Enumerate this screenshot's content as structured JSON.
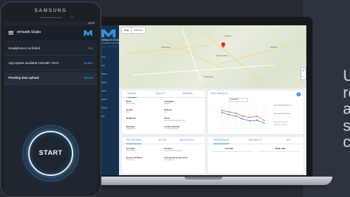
{
  "background_text": {
    "lines": [
      "U",
      "re",
      "a",
      "s",
      "c"
    ]
  },
  "phone": {
    "brand": "SAMSUNG",
    "status_time": "10:30",
    "app_title": "mHealth Studio",
    "rows": [
      {
        "label": "Headphones not linked",
        "action": "link"
      },
      {
        "label": "App update available mHealth +SHS",
        "action": "update"
      },
      {
        "label": "Pending data upload",
        "action": "upload"
      }
    ],
    "start_label": "START"
  },
  "laptop": {
    "brand": "mHEALTH",
    "brand_sub": "STUDIO",
    "sidebar_sub": "mhealthtech.org/mobile",
    "sidebar_items": [
      "Home",
      "Tests",
      "Patients",
      "Results",
      "Clinics",
      "Reports",
      "Settings",
      "Help"
    ],
    "map": {
      "tabs": [
        "Map",
        "Satellite"
      ],
      "towns": [
        "Pretoria",
        "Johannesburg",
        "Vereeniging",
        "Rustenburg",
        "Witbank"
      ]
    },
    "patient_card": {
      "tabs": [
        "PATIENT",
        "FACILITY",
        "GENERAL"
      ],
      "fields": [
        {
          "label": "Name",
          "value": "Jane Smith"
        },
        {
          "label": "Language",
          "value": "English"
        },
        {
          "label": "Gender",
          "value": "Male"
        },
        {
          "label": "Referral",
          "value": "Left"
        },
        {
          "label": "ID Number",
          "value": ""
        },
        {
          "label": "Email",
          "value": "jane.smith@example.com"
        },
        {
          "label": "Birthdate",
          "value": "1990/06/20"
        },
        {
          "label": "Contact Number",
          "value": "+27 81 000 0000"
        }
      ]
    },
    "test_card": {
      "tabs": [
        "TEST DETAILS",
        "NOTES",
        "DEVICE INFO"
      ],
      "fields": [
        {
          "label": "Test Date",
          "value": "2017/01/20"
        },
        {
          "label": "Duration",
          "value": "7 Minutes 30 Seconds"
        },
        {
          "label": "Tester Full Name",
          "value": "John Doe"
        },
        {
          "label": "Average Response Time",
          "value": "0.8 Seconds"
        }
      ]
    },
    "results_card": {
      "title": "TEST RESULTS",
      "select_label": "Audiogram",
      "legend": [
        "Unmasked Air (Right Ear)",
        "Unmasked Air (Left Ear)",
        "Right Ear Threshold",
        "Left Ear Threshold"
      ]
    },
    "thresholds_card": {
      "tabs": [
        "THRESHOLDS",
        "RELIABILITY",
        "SPL"
      ],
      "left_label": "Left (dB)",
      "right_label": "Right (dB)"
    },
    "colors": {
      "sidebar": "#163150",
      "accent": "#3a8fd8",
      "right_ear": "#e05a5a",
      "left_ear": "#4a7fd6"
    }
  }
}
